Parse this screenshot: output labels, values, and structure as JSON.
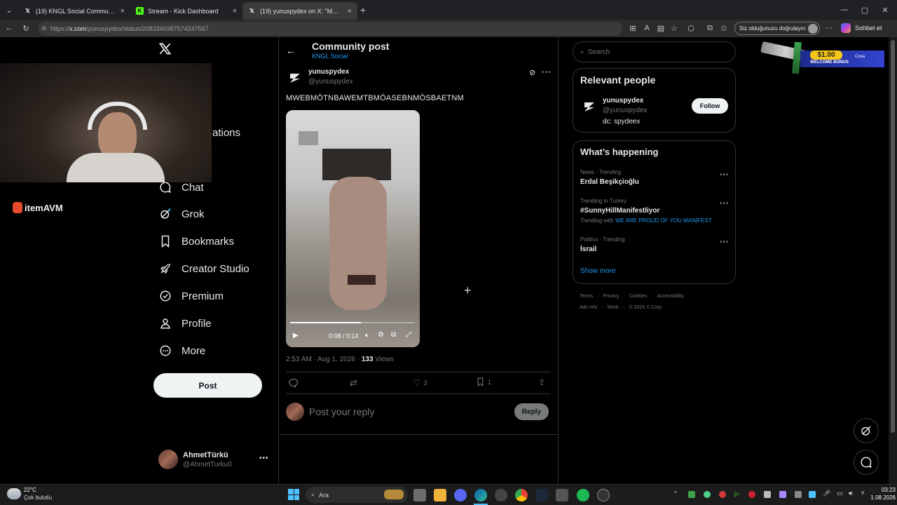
{
  "browser": {
    "tabs": [
      {
        "title": "(19) KNGL Social Community / X",
        "icon": "x-logo-icon"
      },
      {
        "title": "Stream - Kick Dashboard",
        "icon": "kick-logo-icon"
      },
      {
        "title": "(19) yunuspydex on X: \"MWEBMÖ",
        "icon": "x-logo-icon"
      }
    ],
    "url_prefix": "https://",
    "url_host": "x.com",
    "url_path": "/yunuspydex/status/2083340387574247567",
    "verify_button": "Siz olduğunuzu doğrulayın",
    "chat_button": "Sohbet et"
  },
  "nav": {
    "items": [
      {
        "label": "ations",
        "icon": "bell-icon"
      },
      {
        "label": "Chat",
        "icon": "chat-icon"
      },
      {
        "label": "Grok",
        "icon": "grok-icon"
      },
      {
        "label": "Bookmarks",
        "icon": "bookmark-icon"
      },
      {
        "label": "Creator Studio",
        "icon": "rocket-icon"
      },
      {
        "label": "Premium",
        "icon": "verified-icon"
      },
      {
        "label": "Profile",
        "icon": "person-icon"
      },
      {
        "label": "More",
        "icon": "more-circle-icon"
      }
    ],
    "post_button": "Post",
    "account": {
      "name": "AhmetTürkü",
      "handle": "@AhmetTurku0"
    }
  },
  "overlay_logo": "itemAVM",
  "post": {
    "header_title": "Community post",
    "header_sub": "KNGL Social",
    "author_name": "yunuspydex",
    "author_handle": "@yunuspydex",
    "text": "MWEBMÖTNBAWEMTBMÖASEBNMÖSBAETNM",
    "video_time": "0:08 / 0:14",
    "video_progress": 0.57,
    "timestamp": "2:53 AM · Aug 1, 2026 · ",
    "views_count": "133",
    "views_label": " Views",
    "likes": "3",
    "bookmarks": "1",
    "reply_placeholder": "Post your reply",
    "reply_button": "Reply"
  },
  "right": {
    "search_placeholder": "Search",
    "relevant_title": "Relevant people",
    "person": {
      "name": "yunuspydex",
      "handle": "@yunuspydex",
      "bio": "dc: spydeex",
      "follow": "Follow"
    },
    "happening_title": "What’s happening",
    "trends": [
      {
        "meta": "News · Trending",
        "title": "Erdal Beşikçioğlu",
        "extra_label": "",
        "extra_link": ""
      },
      {
        "meta": "Trending in Turkey",
        "title": "#SunnyHillManifestliyor",
        "extra_label": "Trending with ",
        "extra_link": "WE ARE PROUD OF YOU MANİFEST"
      },
      {
        "meta": "Politics · Trending",
        "title": "İsrail",
        "extra_label": "",
        "extra_link": ""
      }
    ],
    "show_more": "Show more",
    "footer_row1": [
      "Terms",
      "Privacy",
      "Cookies",
      "Accessibility"
    ],
    "footer_row2": [
      "Ads info",
      "More ···",
      "© 2026 X Corp."
    ]
  },
  "ad": {
    "amount": "$1.00",
    "caption": "WELCOME BONUS",
    "brand": "Cosa"
  },
  "taskbar": {
    "temp": "22°C",
    "weather": "Çok bulutlu",
    "search": "Ara",
    "time": "03:23",
    "date": "1.08.2026"
  }
}
